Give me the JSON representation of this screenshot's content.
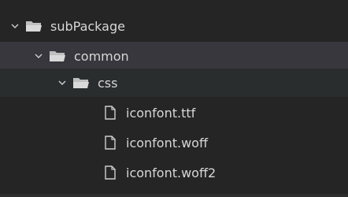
{
  "explorer": {
    "items": [
      {
        "label": "subPackage",
        "type": "folder",
        "expanded": true,
        "depth": 0
      },
      {
        "label": "common",
        "type": "folder",
        "expanded": true,
        "depth": 1
      },
      {
        "label": "css",
        "type": "folder",
        "expanded": true,
        "depth": 2
      },
      {
        "label": "iconfont.ttf",
        "type": "file",
        "depth": 3
      },
      {
        "label": "iconfont.woff",
        "type": "file",
        "depth": 3
      },
      {
        "label": "iconfont.woff2",
        "type": "file",
        "depth": 3
      }
    ]
  },
  "colors": {
    "background": "#252526",
    "selected_row": "#37373d",
    "hover_row": "#2a2d2e",
    "text": "#d7d7d7",
    "icon": "#cfcfcf"
  },
  "icons": {
    "chevron": "chevron-down-icon",
    "folder": "folder-open-icon",
    "file": "file-icon"
  }
}
